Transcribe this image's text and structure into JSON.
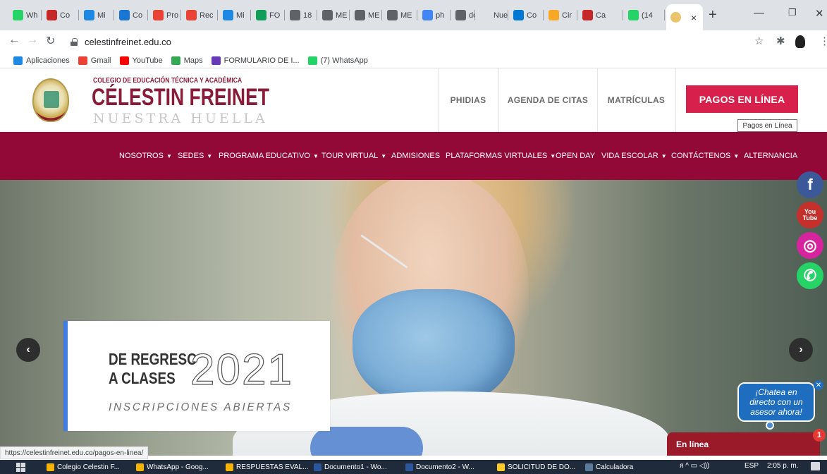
{
  "browser": {
    "tabs": [
      {
        "label": "Wh",
        "color": "#25d366"
      },
      {
        "label": "Co",
        "color": "#c62828"
      },
      {
        "label": "Mi",
        "color": "#1e88e5"
      },
      {
        "label": "Co",
        "color": "#1976d2"
      },
      {
        "label": "Pro",
        "color": "#ea4335"
      },
      {
        "label": "Rec",
        "color": "#ea4335"
      },
      {
        "label": "Mi",
        "color": "#1e88e5"
      },
      {
        "label": "FO",
        "color": "#0f9d58"
      },
      {
        "label": "18",
        "color": "#5f6368"
      },
      {
        "label": "ME",
        "color": "#5f6368"
      },
      {
        "label": "ME",
        "color": "#5f6368"
      },
      {
        "label": "ME",
        "color": "#5f6368"
      },
      {
        "label": "ph",
        "color": "#4285f4"
      },
      {
        "label": "do",
        "color": "#5f6368"
      },
      {
        "label": "Nueva",
        "color": "#dee1e6"
      },
      {
        "label": "Co",
        "color": "#0078d4"
      },
      {
        "label": "Cir",
        "color": "#f9a825"
      },
      {
        "label": "Ca",
        "color": "#c62828"
      },
      {
        "label": "(14",
        "color": "#25d366"
      }
    ],
    "url": "celestinfreinet.edu.co",
    "bookmarks": [
      {
        "label": "Aplicaciones",
        "color": "#1e88e5"
      },
      {
        "label": "Gmail",
        "color": "#ea4335"
      },
      {
        "label": "YouTube",
        "color": "#ff0000"
      },
      {
        "label": "Maps",
        "color": "#34a853"
      },
      {
        "label": "FORMULARIO DE I...",
        "color": "#673ab7"
      },
      {
        "label": "(7) WhatsApp",
        "color": "#25d366"
      }
    ]
  },
  "site": {
    "school_line1": "COLEGIO DE EDUCACIÓN TÉCNICA Y ACADÉMICA",
    "school_name": "CÉLESTIN FREINET",
    "school_tagline": "NUESTRA HUELLA",
    "header_nav": [
      "PHIDIAS",
      "AGENDA DE CITAS",
      "MATRÍCULAS"
    ],
    "pay_button": "PAGOS EN LÍNEA",
    "tooltip": "Pagos en Línea",
    "main_nav": [
      {
        "label": "NOSOTROS",
        "caret": true
      },
      {
        "label": "SEDES",
        "caret": true
      },
      {
        "label": "PROGRAMA EDUCATIVO",
        "caret": true
      },
      {
        "label": "TOUR VIRTUAL",
        "caret": true
      },
      {
        "label": "ADMISIONES",
        "caret": false
      },
      {
        "label": "PLATAFORMAS VIRTUALES",
        "caret": true
      },
      {
        "label": "OPEN DAY",
        "caret": false
      },
      {
        "label": "VIDA ESCOLAR",
        "caret": true
      },
      {
        "label": "CONTÁCTENOS",
        "caret": true
      },
      {
        "label": "ALTERNANCIA",
        "caret": false
      }
    ],
    "hero": {
      "line1": "DE REGRESO",
      "line2": "A CLASES",
      "year": "2021",
      "subtitle": "INSCRIPCIONES ABIERTAS"
    },
    "social": [
      {
        "icon": "facebook-icon",
        "glyph": "f",
        "color": "#3b5998"
      },
      {
        "icon": "youtube-icon",
        "glyph": "You\nTube",
        "color": "#c4302b"
      },
      {
        "icon": "instagram-icon",
        "glyph": "◎",
        "color": "#d6249f"
      },
      {
        "icon": "whatsapp-icon",
        "glyph": "✆",
        "color": "#25d366"
      }
    ],
    "chat": {
      "bubble": "¡Chatea en directo con un asesor ahora!",
      "bar_label": "En línea",
      "badge": "1"
    }
  },
  "status_url": "https://celestinfreinet.edu.co/pagos-en-linea/",
  "taskbar": {
    "items": [
      {
        "label": "Colegio Celestin F...",
        "color": "#f4b400"
      },
      {
        "label": "WhatsApp - Goog...",
        "color": "#f4b400"
      },
      {
        "label": "RESPUESTAS EVAL...",
        "color": "#f4b400"
      },
      {
        "label": "Documento1 - Wo...",
        "color": "#2b579a"
      },
      {
        "label": "Documento2 - W...",
        "color": "#2b579a"
      },
      {
        "label": "SOLICITUD DE DO...",
        "color": "#ffca28"
      },
      {
        "label": "Calculadora",
        "color": "#5c7a99"
      }
    ],
    "lang": "ESP",
    "time": "2:05 p. m."
  }
}
